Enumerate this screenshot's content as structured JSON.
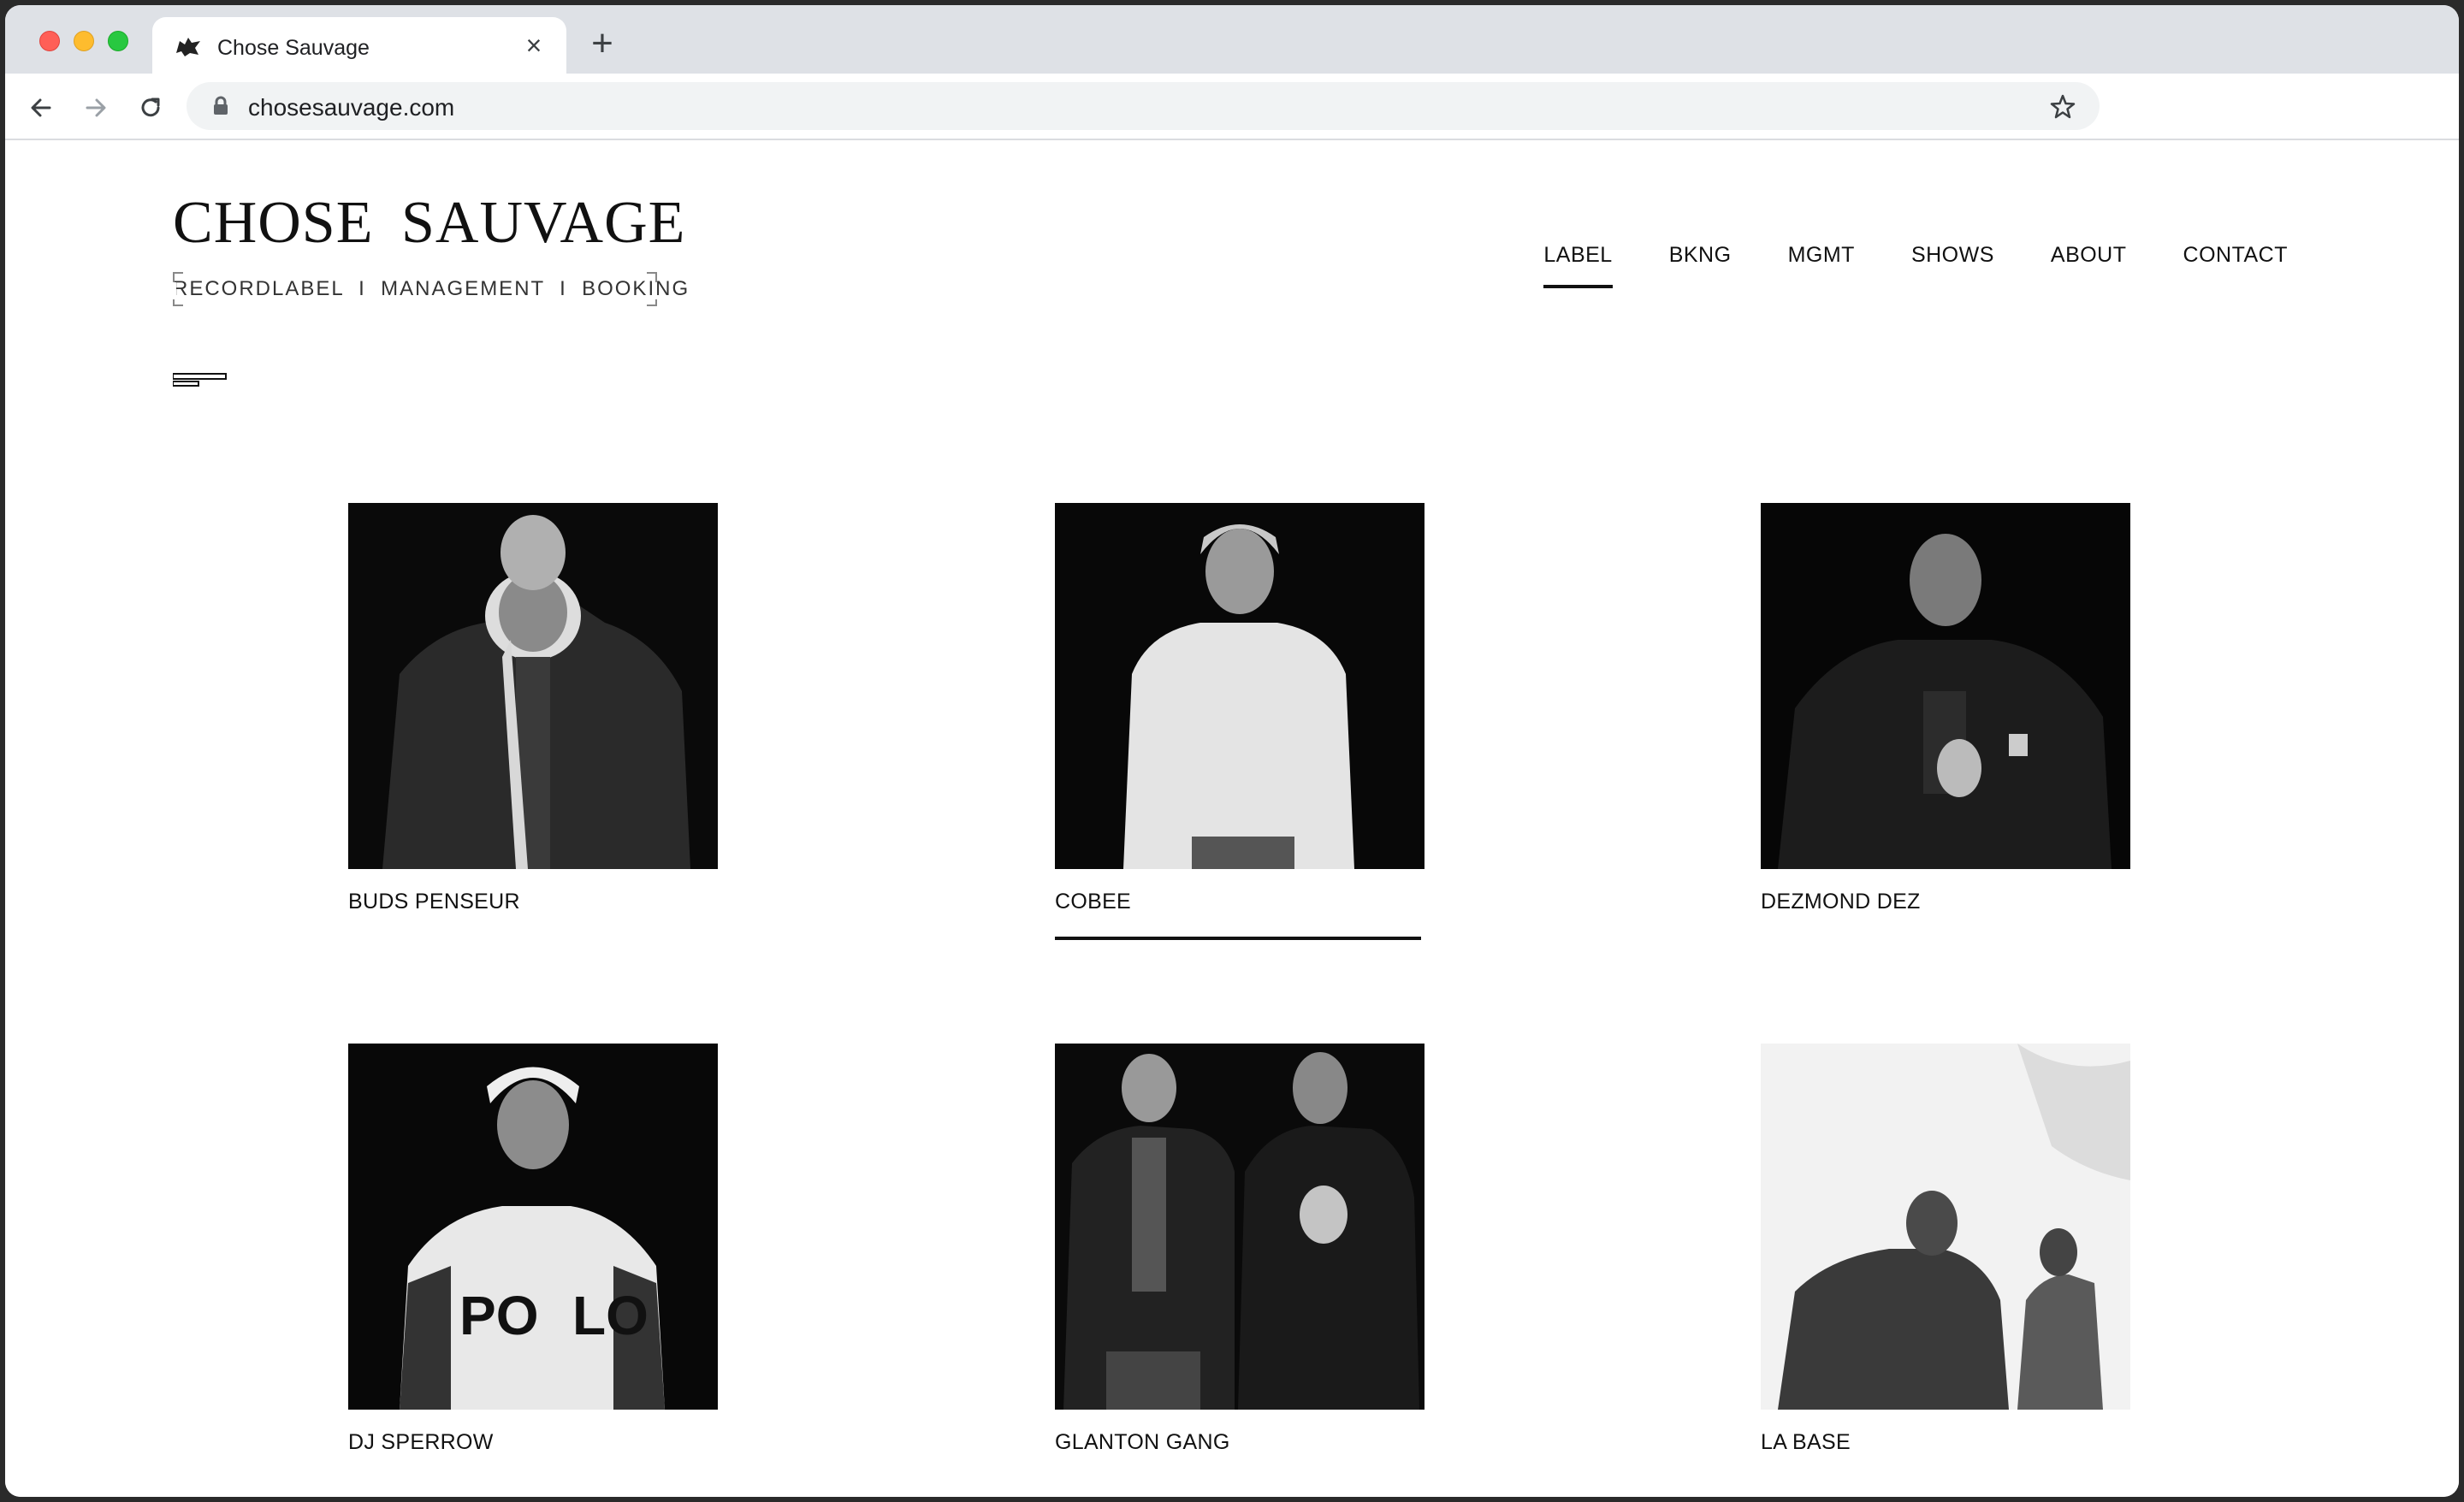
{
  "browser": {
    "tab_title": "Chose Sauvage",
    "url": "chosesauvage.com"
  },
  "site": {
    "logo_title": "CHOSE SAUVAGE",
    "logo_tagline": "RECORDLABEL  I  MANAGEMENT  I  BOOKING",
    "nav": [
      {
        "label": "LABEL",
        "active": true
      },
      {
        "label": "BKNG",
        "active": false
      },
      {
        "label": "MGMT",
        "active": false
      },
      {
        "label": "SHOWS",
        "active": false
      },
      {
        "label": "ABOUT",
        "active": false
      },
      {
        "label": "CONTACT",
        "active": false
      }
    ]
  },
  "artists": [
    {
      "name": "BUDS PENSEUR",
      "photo": "dark"
    },
    {
      "name": "COBEE",
      "photo": "dark",
      "active": true
    },
    {
      "name": "DEZMOND DEZ",
      "photo": "dark"
    },
    {
      "name": "DJ SPERROW",
      "photo": "dark"
    },
    {
      "name": "GLANTON GANG",
      "photo": "dark"
    },
    {
      "name": "LA BASE",
      "photo": "light"
    }
  ],
  "colors": {
    "text": "#111111",
    "background": "#ffffff",
    "tabstrip": "#dee1e6"
  }
}
